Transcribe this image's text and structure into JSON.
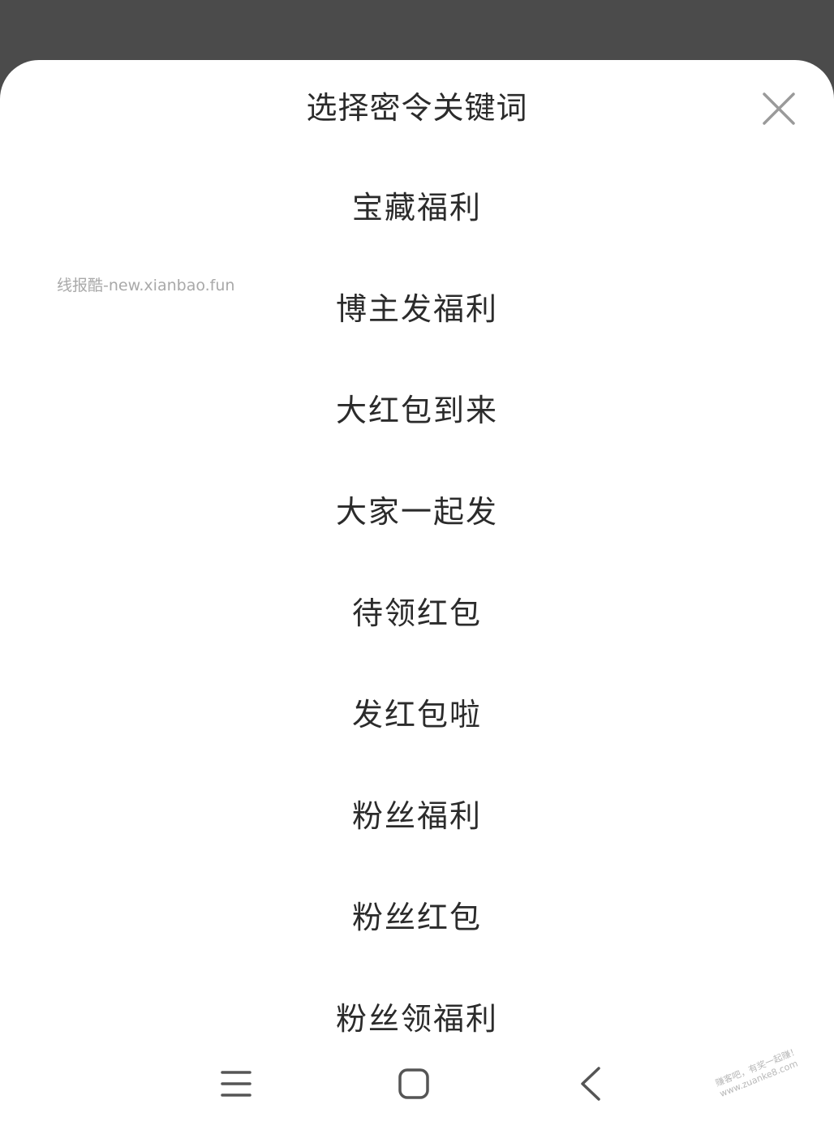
{
  "sheet": {
    "title": "选择密令关键词",
    "close_icon": "close-icon"
  },
  "keywords": [
    {
      "label": "宝藏福利"
    },
    {
      "label": "博主发福利"
    },
    {
      "label": "大红包到来"
    },
    {
      "label": "大家一起发"
    },
    {
      "label": "待领红包"
    },
    {
      "label": "发红包啦"
    },
    {
      "label": "粉丝福利"
    },
    {
      "label": "粉丝红包"
    },
    {
      "label": "粉丝领福利"
    }
  ],
  "watermarks": {
    "left": "线报酷-new.xianbao.fun",
    "corner_line1": "赚客吧，有奖一起赚！",
    "corner_line2": "www.zuanke8.com"
  },
  "navbar": {
    "menu_icon": "menu-icon",
    "home_icon": "home-icon",
    "back_icon": "back-icon"
  },
  "colors": {
    "backdrop": "#4b4b4b",
    "sheet": "#ffffff",
    "text": "#2b2b2b",
    "icon": "#555555",
    "close": "#9a9a9a"
  }
}
